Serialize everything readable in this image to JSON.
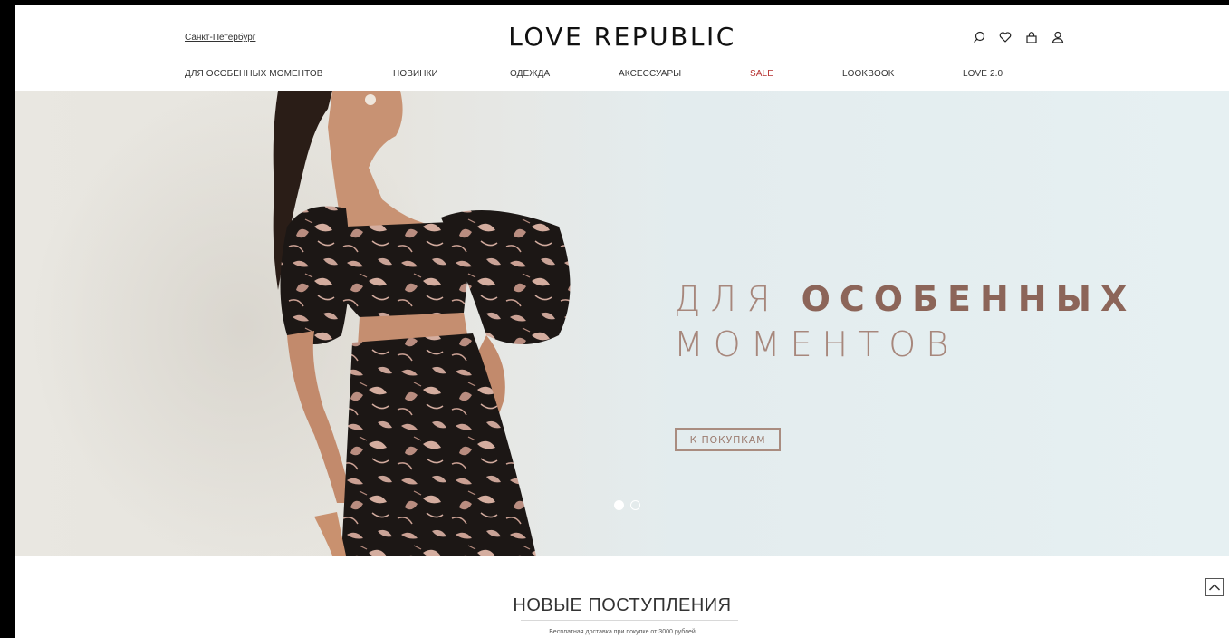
{
  "header": {
    "city": "Санкт-Петербург",
    "logo": "LOVE REPUBLIC",
    "icons": [
      "search-icon",
      "heart-icon",
      "bag-icon",
      "user-icon"
    ]
  },
  "nav": {
    "items": [
      {
        "label": "ДЛЯ ОСОБЕННЫХ МОМЕНТОВ"
      },
      {
        "label": "НОВИНКИ"
      },
      {
        "label": "ОДЕЖДА"
      },
      {
        "label": "АКСЕССУАРЫ"
      },
      {
        "label": "SALE"
      },
      {
        "label": "LOOKBOOK"
      },
      {
        "label": "LOVE 2.0"
      }
    ]
  },
  "hero": {
    "title_light": "ДЛЯ",
    "title_bold": "ОСОБЕННЫХ",
    "title_line2": "МОМЕНТОВ",
    "button": "К ПОКУПКАМ",
    "slides": 2,
    "active_slide": 1
  },
  "new_arrivals": {
    "title": "НОВЫЕ ПОСТУПЛЕНИЯ",
    "subtitle": "Бесплатная доставка при покупке от 3000 рублей"
  },
  "colors": {
    "accent": "#a7877c",
    "accent_dark": "#8c6559",
    "sale": "#b5302f",
    "hero_bg": "#e3ecee"
  }
}
